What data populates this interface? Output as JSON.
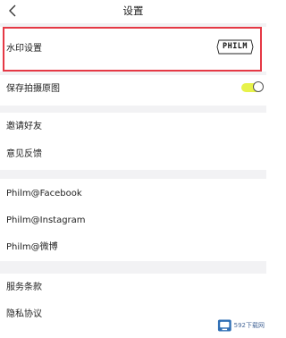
{
  "header": {
    "title": "设置",
    "back_icon": "chevron-left-icon"
  },
  "sections": {
    "watermark": {
      "label": "水印设置",
      "badge_text": "PHILM"
    },
    "save_photo": {
      "label": "保存拍摄原图",
      "toggle_on": true,
      "toggle_color": "#e7f24a"
    },
    "social": {
      "invite_label": "邀请好友",
      "feedback_label": "意见反馈"
    },
    "accounts": {
      "facebook_label": "Philm@Facebook",
      "instagram_label": "Philm@Instagram",
      "weibo_label": "Philm@微博"
    },
    "legal": {
      "terms_label": "服务条款",
      "privacy_label": "隐私协议"
    }
  },
  "highlight_color": "#e53945",
  "corner_watermark": {
    "text": "592下载网",
    "icon": "site-logo-icon"
  }
}
